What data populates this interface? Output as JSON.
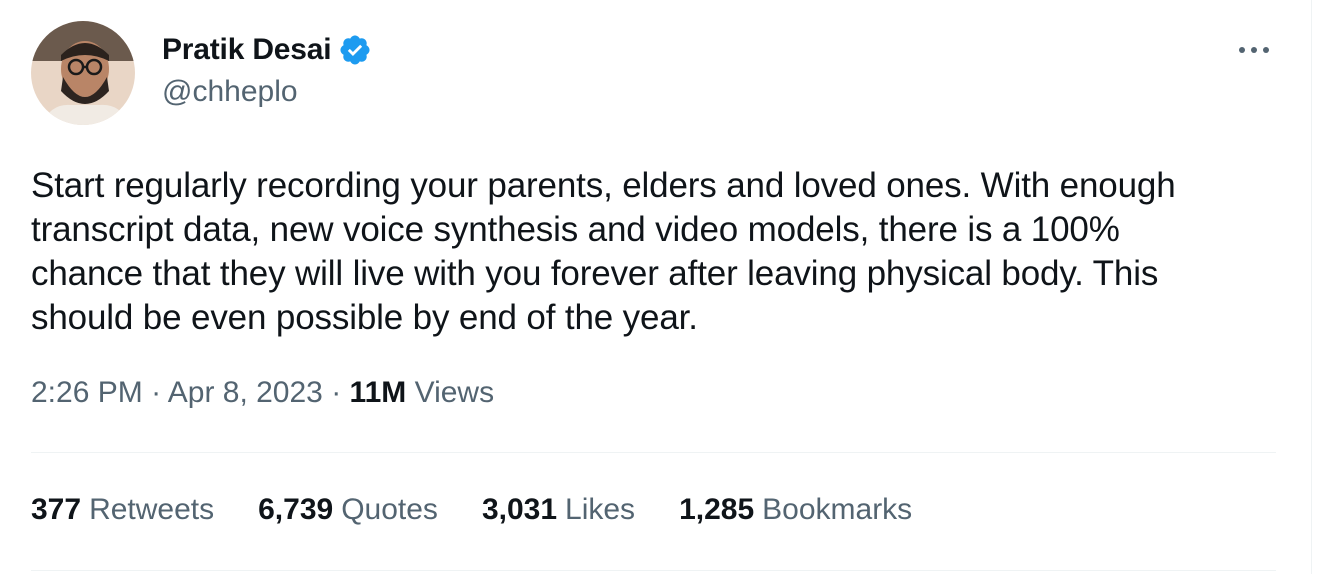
{
  "author": {
    "display_name": "Pratik Desai",
    "handle": "@chheplo",
    "verified": true
  },
  "tweet": {
    "text": "Start regularly recording your parents, elders and loved ones. With enough\ntranscript data, new voice synthesis and video models, there is a 100%\nchance that they will live with you forever after leaving physical body. This\nshould be even possible by end of the year.",
    "time": "2:26 PM",
    "date": "Apr 8, 2023",
    "separator": "·",
    "views_count": "11M",
    "views_label": "Views"
  },
  "stats": [
    {
      "count": "377",
      "label": "Retweets"
    },
    {
      "count": "6,739",
      "label": "Quotes"
    },
    {
      "count": "3,031",
      "label": "Likes"
    },
    {
      "count": "1,285",
      "label": "Bookmarks"
    }
  ],
  "icons": {
    "verified": "verified-badge-icon",
    "more": "more-horizontal-icon"
  },
  "colors": {
    "text_primary": "#0f1419",
    "text_secondary": "#536471",
    "verified_blue": "#1d9bf0",
    "divider": "#eff3f4"
  }
}
